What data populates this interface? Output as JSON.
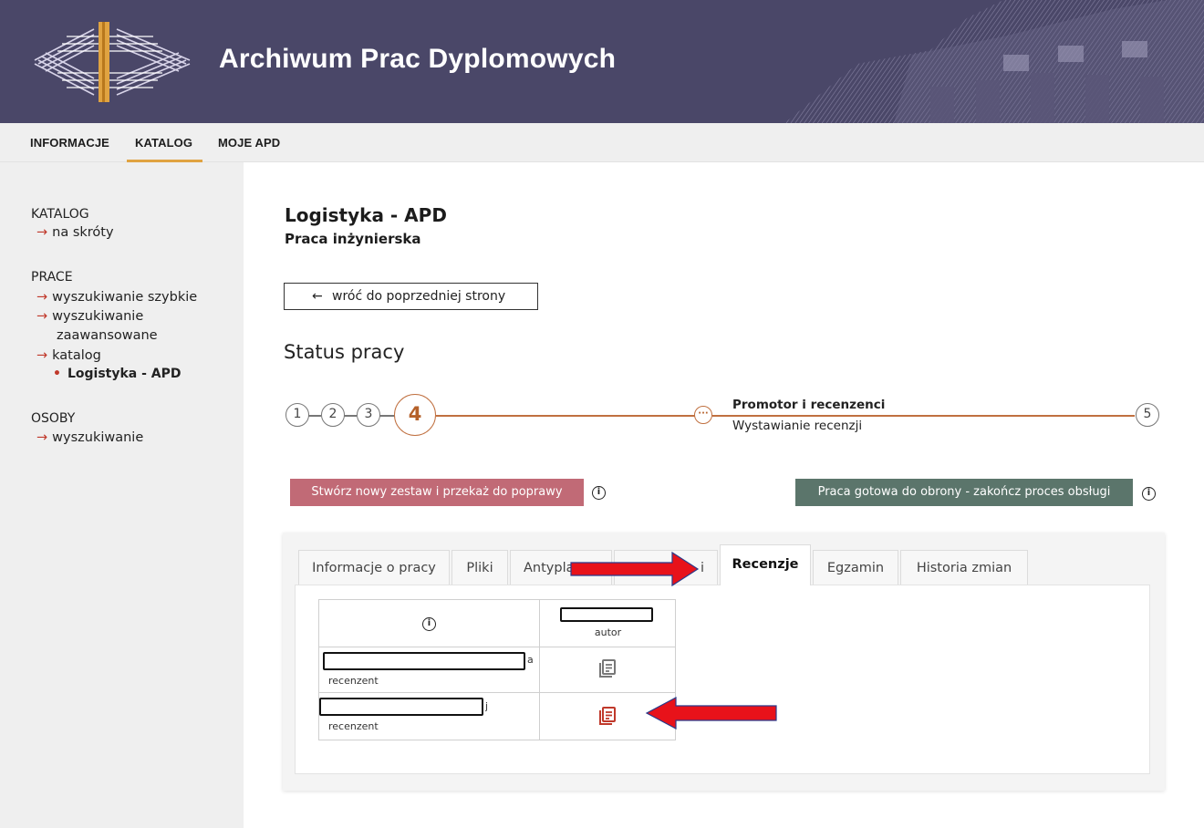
{
  "header": {
    "title": "Archiwum Prac Dyplomowych"
  },
  "topnav": {
    "items": [
      {
        "label": "INFORMACJE"
      },
      {
        "label": "KATALOG"
      },
      {
        "label": "MOJE APD"
      }
    ],
    "active": "KATALOG"
  },
  "sidebar": {
    "groups": [
      {
        "title": "KATALOG",
        "links": [
          "na skróty"
        ]
      },
      {
        "title": "PRACE",
        "links": [
          "wyszukiwanie szybkie",
          "wyszukiwanie zaawansowane",
          "katalog"
        ],
        "active": "Logistyka - APD"
      },
      {
        "title": "OSOBY",
        "links": [
          "wyszukiwanie"
        ]
      }
    ]
  },
  "main": {
    "title": "Logistyka - APD",
    "subtitle": "Praca inżynierska",
    "back_button": "wróć do poprzedniej strony",
    "status_title": "Status pracy"
  },
  "stepper": {
    "steps": [
      "1",
      "2",
      "3",
      "4",
      "5"
    ],
    "current": "4",
    "substep_icon": "···",
    "substep_label": "Promotor i recenzenci",
    "substep_status": "Wystawianie recenzji"
  },
  "actions": {
    "reject_label": "Stwórz nowy zestaw i przekaż do poprawy",
    "finish_label": "Praca gotowa do obrony - zakończ proces obsługi"
  },
  "tabs": [
    {
      "label": "Informacje o pracy"
    },
    {
      "label": "Pliki"
    },
    {
      "label": "Antypla"
    },
    {
      "label": "i"
    },
    {
      "label": "Recenzje"
    },
    {
      "label": "Egzamin"
    },
    {
      "label": "Historia zmian"
    }
  ],
  "active_tab": "Recenzje",
  "review_table": {
    "header_col_label": "autor",
    "rows": [
      {
        "name_suffix": "a",
        "role": "recenzent",
        "icon": "document-list-icon",
        "icon_color": "#777777"
      },
      {
        "name_suffix": "j",
        "role": "recenzent",
        "icon": "document-list-icon",
        "icon_color": "#c0392b"
      }
    ]
  },
  "colors": {
    "header_bg": "#4a4768",
    "accent_underline": "#e0a341",
    "link_arrow": "#c0392b",
    "stepper_active": "#c07040",
    "reject_button": "#c16a76",
    "finish_button": "#5b756b",
    "annotation_arrow": "#e8121a"
  }
}
